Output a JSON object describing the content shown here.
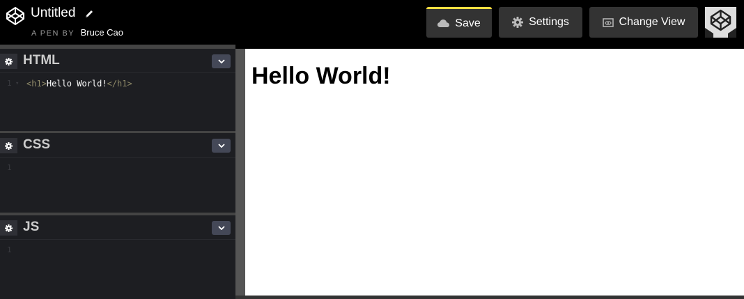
{
  "header": {
    "title": "Untitled",
    "pen_by_label": "A PEN BY",
    "author": "Bruce Cao",
    "buttons": {
      "save": "Save",
      "settings": "Settings",
      "change_view": "Change View"
    },
    "accent_color": "#ffdd40"
  },
  "editors": [
    {
      "title": "HTML",
      "lines": [
        {
          "number": "1",
          "open_tag": "<h1>",
          "text": "Hello World!",
          "close_tag": "</h1>"
        }
      ]
    },
    {
      "title": "CSS",
      "lines": [
        {
          "number": "1"
        }
      ]
    },
    {
      "title": "JS",
      "lines": [
        {
          "number": "1"
        }
      ]
    }
  ],
  "preview": {
    "heading": "Hello World!"
  },
  "icons": {
    "logo": "codepen-logo-icon",
    "edit": "pencil-icon",
    "save": "cloud-icon",
    "settings": "gear-icon",
    "view": "eye-icon",
    "panel_settings": "gear-icon",
    "collapse": "chevron-down-icon"
  }
}
